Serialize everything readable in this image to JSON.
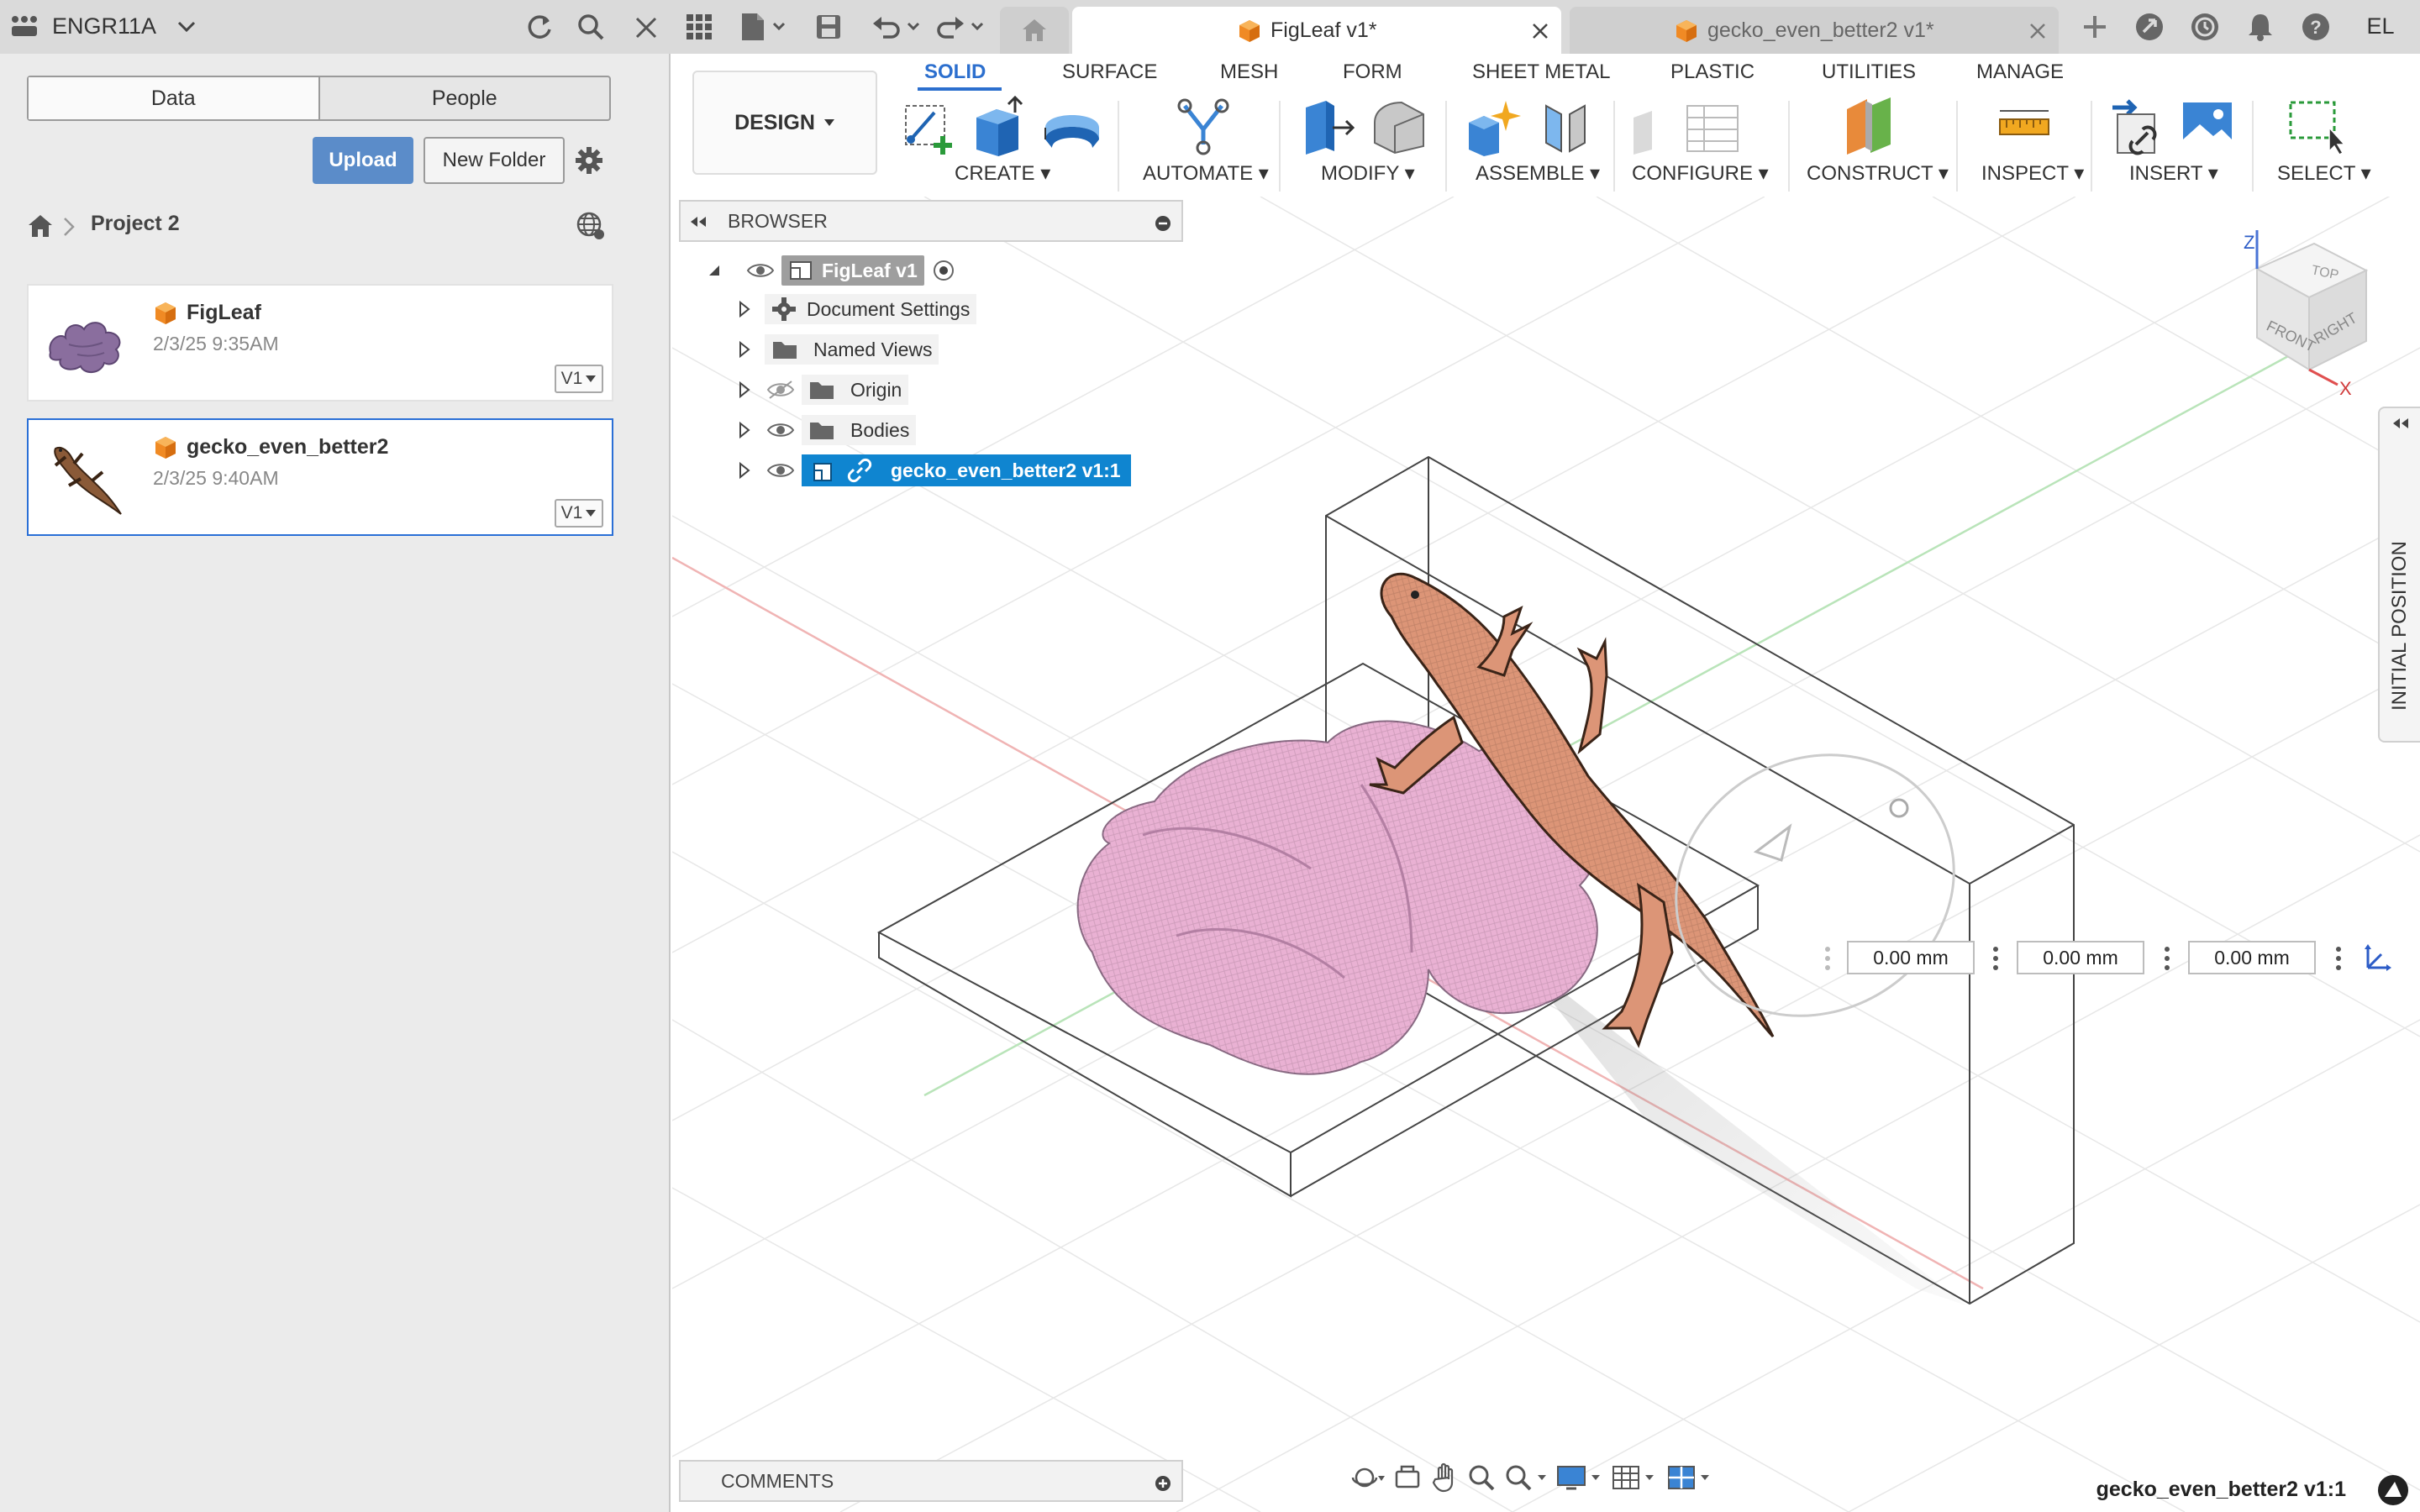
{
  "topbar": {
    "team_name": "ENGR11A",
    "tabs": [
      {
        "label": "FigLeaf v1*",
        "active": true
      },
      {
        "label": "gecko_even_better2 v1*",
        "active": false
      }
    ],
    "user_initials": "EL",
    "icons": [
      "apps-icon",
      "chevron-down-icon",
      "refresh-icon",
      "search-icon",
      "close-icon",
      "grid-icon",
      "file-icon",
      "save-icon",
      "undo-icon",
      "redo-icon",
      "home-icon",
      "add-tab-icon",
      "extensions-icon",
      "job-status-icon",
      "notifications-icon",
      "help-icon"
    ]
  },
  "left_panel": {
    "segments": [
      "Data",
      "People"
    ],
    "upload_label": "Upload",
    "new_folder_label": "New Folder",
    "breadcrumb": {
      "project": "Project 2"
    },
    "files": [
      {
        "name": "FigLeaf",
        "date": "2/3/25 9:35AM",
        "version": "V1"
      },
      {
        "name": "gecko_even_better2",
        "date": "2/3/25 9:40AM",
        "version": "V1"
      }
    ]
  },
  "toolbar": {
    "workspace_tabs": [
      "SOLID",
      "SURFACE",
      "MESH",
      "FORM",
      "SHEET METAL",
      "PLASTIC",
      "UTILITIES",
      "MANAGE"
    ],
    "active_tab": "SOLID",
    "design_label": "DESIGN",
    "groups": [
      "CREATE",
      "AUTOMATE",
      "MODIFY",
      "ASSEMBLE",
      "CONFIGURE",
      "CONSTRUCT",
      "INSPECT",
      "INSERT",
      "SELECT"
    ]
  },
  "browser": {
    "title": "BROWSER",
    "root": "FigLeaf v1",
    "items": [
      "Document Settings",
      "Named Views",
      "Origin",
      "Bodies",
      "gecko_even_better2 v1:1"
    ]
  },
  "viewcube": {
    "top": "TOP",
    "front": "FRONT",
    "right": "RIGHT",
    "axis_z": "Z",
    "axis_x": "X"
  },
  "move_inputs": [
    "0.00 mm",
    "0.00 mm",
    "0.00 mm"
  ],
  "side_panel_label": "INITIAL POSITION",
  "comments_label": "COMMENTS",
  "status_component": "gecko_even_better2 v1:1",
  "colors": {
    "accent": "#2c6fce",
    "highlight": "#0f85d0",
    "gecko": "#d9906e",
    "leaf": "#e7a9cf"
  }
}
